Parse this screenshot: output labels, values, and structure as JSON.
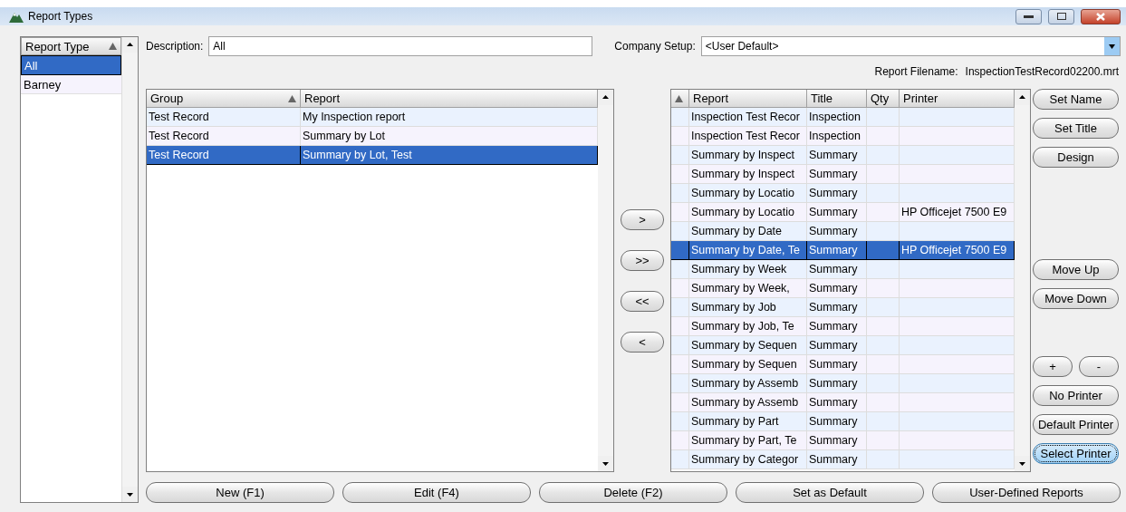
{
  "window": {
    "title": "Report Types"
  },
  "report_types": {
    "header": "Report Type",
    "items": [
      {
        "label": "All",
        "selected": true
      },
      {
        "label": "Barney",
        "selected": false
      }
    ]
  },
  "description": {
    "label": "Description:",
    "value": "All"
  },
  "company_setup": {
    "label": "Company Setup:",
    "value": "<User Default>"
  },
  "report_filename": {
    "label": "Report Filename:",
    "value": "InspectionTestRecord02200.mrt"
  },
  "available_reports": {
    "columns": [
      "Group",
      "Report"
    ],
    "rows": [
      {
        "cells": [
          "Test Record",
          "My Inspection report"
        ],
        "selected": false
      },
      {
        "cells": [
          "Test Record",
          "Summary by Lot"
        ],
        "selected": false
      },
      {
        "cells": [
          "Test Record",
          "Summary by Lot, Test"
        ],
        "selected": true
      }
    ]
  },
  "transfer_buttons": [
    ">",
    ">>",
    "<<",
    "<"
  ],
  "assigned_reports": {
    "columns": [
      "Report",
      "Title",
      "Qty",
      "Printer"
    ],
    "rows": [
      {
        "cells": [
          "Inspection Test Recor",
          "Inspection",
          "",
          ""
        ],
        "selected": false
      },
      {
        "cells": [
          "Inspection Test Recor",
          "Inspection",
          "",
          ""
        ],
        "selected": false
      },
      {
        "cells": [
          "Summary by Inspect",
          "Summary",
          "",
          ""
        ],
        "selected": false
      },
      {
        "cells": [
          "Summary by Inspect",
          "Summary",
          "",
          ""
        ],
        "selected": false
      },
      {
        "cells": [
          "Summary by Locatio",
          "Summary",
          "",
          ""
        ],
        "selected": false
      },
      {
        "cells": [
          "Summary by Locatio",
          "Summary",
          "",
          "HP Officejet 7500 E9"
        ],
        "selected": false
      },
      {
        "cells": [
          "Summary by Date",
          "Summary",
          "",
          ""
        ],
        "selected": false
      },
      {
        "cells": [
          "Summary by Date, Te",
          "Summary",
          "",
          "HP Officejet 7500 E9"
        ],
        "selected": true
      },
      {
        "cells": [
          "Summary by Week",
          "Summary",
          "",
          ""
        ],
        "selected": false
      },
      {
        "cells": [
          "Summary by Week,",
          "Summary",
          "",
          ""
        ],
        "selected": false
      },
      {
        "cells": [
          "Summary by Job",
          "Summary",
          "",
          ""
        ],
        "selected": false
      },
      {
        "cells": [
          "Summary by Job, Te",
          "Summary",
          "",
          ""
        ],
        "selected": false
      },
      {
        "cells": [
          "Summary by Sequen",
          "Summary",
          "",
          ""
        ],
        "selected": false
      },
      {
        "cells": [
          "Summary by Sequen",
          "Summary",
          "",
          ""
        ],
        "selected": false
      },
      {
        "cells": [
          "Summary by Assemb",
          "Summary",
          "",
          ""
        ],
        "selected": false
      },
      {
        "cells": [
          "Summary by Assemb",
          "Summary",
          "",
          ""
        ],
        "selected": false
      },
      {
        "cells": [
          "Summary by Part",
          "Summary",
          "",
          ""
        ],
        "selected": false
      },
      {
        "cells": [
          "Summary by Part, Te",
          "Summary",
          "",
          ""
        ],
        "selected": false
      },
      {
        "cells": [
          "Summary by Categor",
          "Summary",
          "",
          ""
        ],
        "selected": false
      }
    ]
  },
  "side_buttons": [
    {
      "label": "Set Name",
      "focused": false
    },
    {
      "label": "Set Title",
      "focused": false
    },
    {
      "label": "Design",
      "focused": false
    },
    {
      "label": "Move Up",
      "focused": false
    },
    {
      "label": "Move Down",
      "focused": false
    },
    {
      "label": "+",
      "focused": false
    },
    {
      "label": "-",
      "focused": false
    },
    {
      "label": "No Printer",
      "focused": false
    },
    {
      "label": "Default Printer",
      "focused": false
    },
    {
      "label": "Select Printer",
      "focused": true
    }
  ],
  "bottom_buttons": [
    "New (F1)",
    "Edit (F4)",
    "Delete (F2)",
    "Set as Default",
    "User-Defined Reports"
  ]
}
